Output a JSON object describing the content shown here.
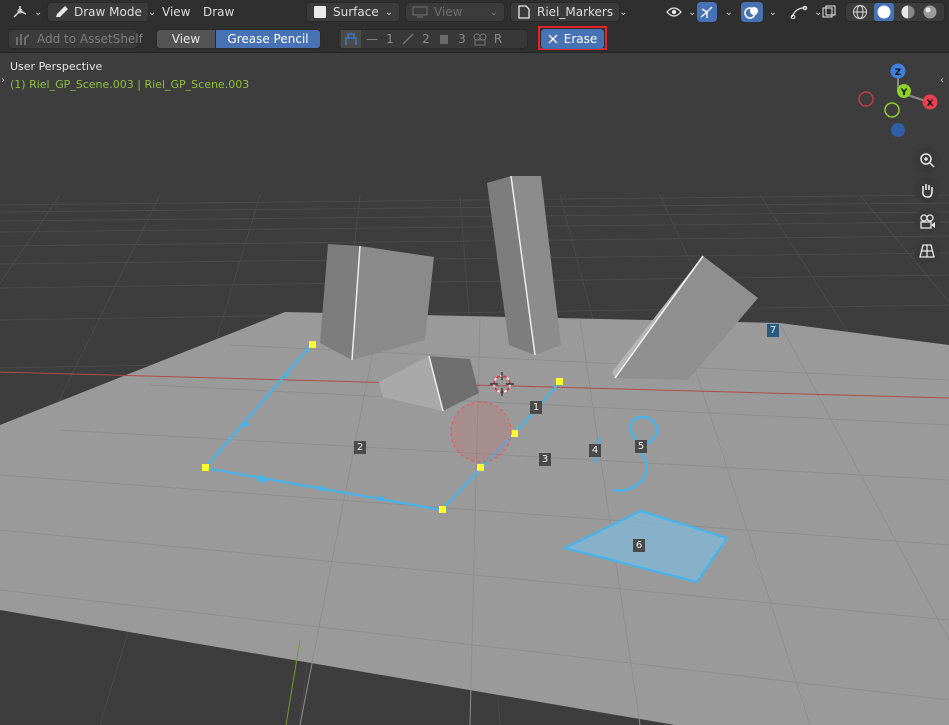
{
  "header": {
    "mode_label": "Draw Mode",
    "view_menu": "View",
    "draw_menu": "Draw",
    "surface_label": "Surface",
    "view_dropdown": "View",
    "layer_label": "Riel_Markers"
  },
  "toolbar": {
    "asset_shelf": "Add to AssetShelf",
    "tab_view": "View",
    "tab_grease_pencil": "Grease Pencil",
    "num_1": "1",
    "num_2": "2",
    "num_3": "3",
    "num_r": "R",
    "erase_label": "Erase"
  },
  "viewport": {
    "perspective": "User Perspective",
    "object_info": "(1) Riel_GP_Scene.003 | Riel_GP_Scene.003",
    "markers": [
      "1",
      "2",
      "3",
      "4",
      "5",
      "6",
      "7"
    ]
  },
  "gizmo": {
    "z": "Z",
    "y": "Y",
    "x": "X"
  },
  "colors": {
    "accent": "#4772b3",
    "erase_highlight": "#e0262b",
    "stroke": "#3fb6f2",
    "point": "#ffff2f",
    "axis_x": "#e8404f",
    "axis_y": "#8fcf2a",
    "axis_z": "#3f7fe0"
  }
}
